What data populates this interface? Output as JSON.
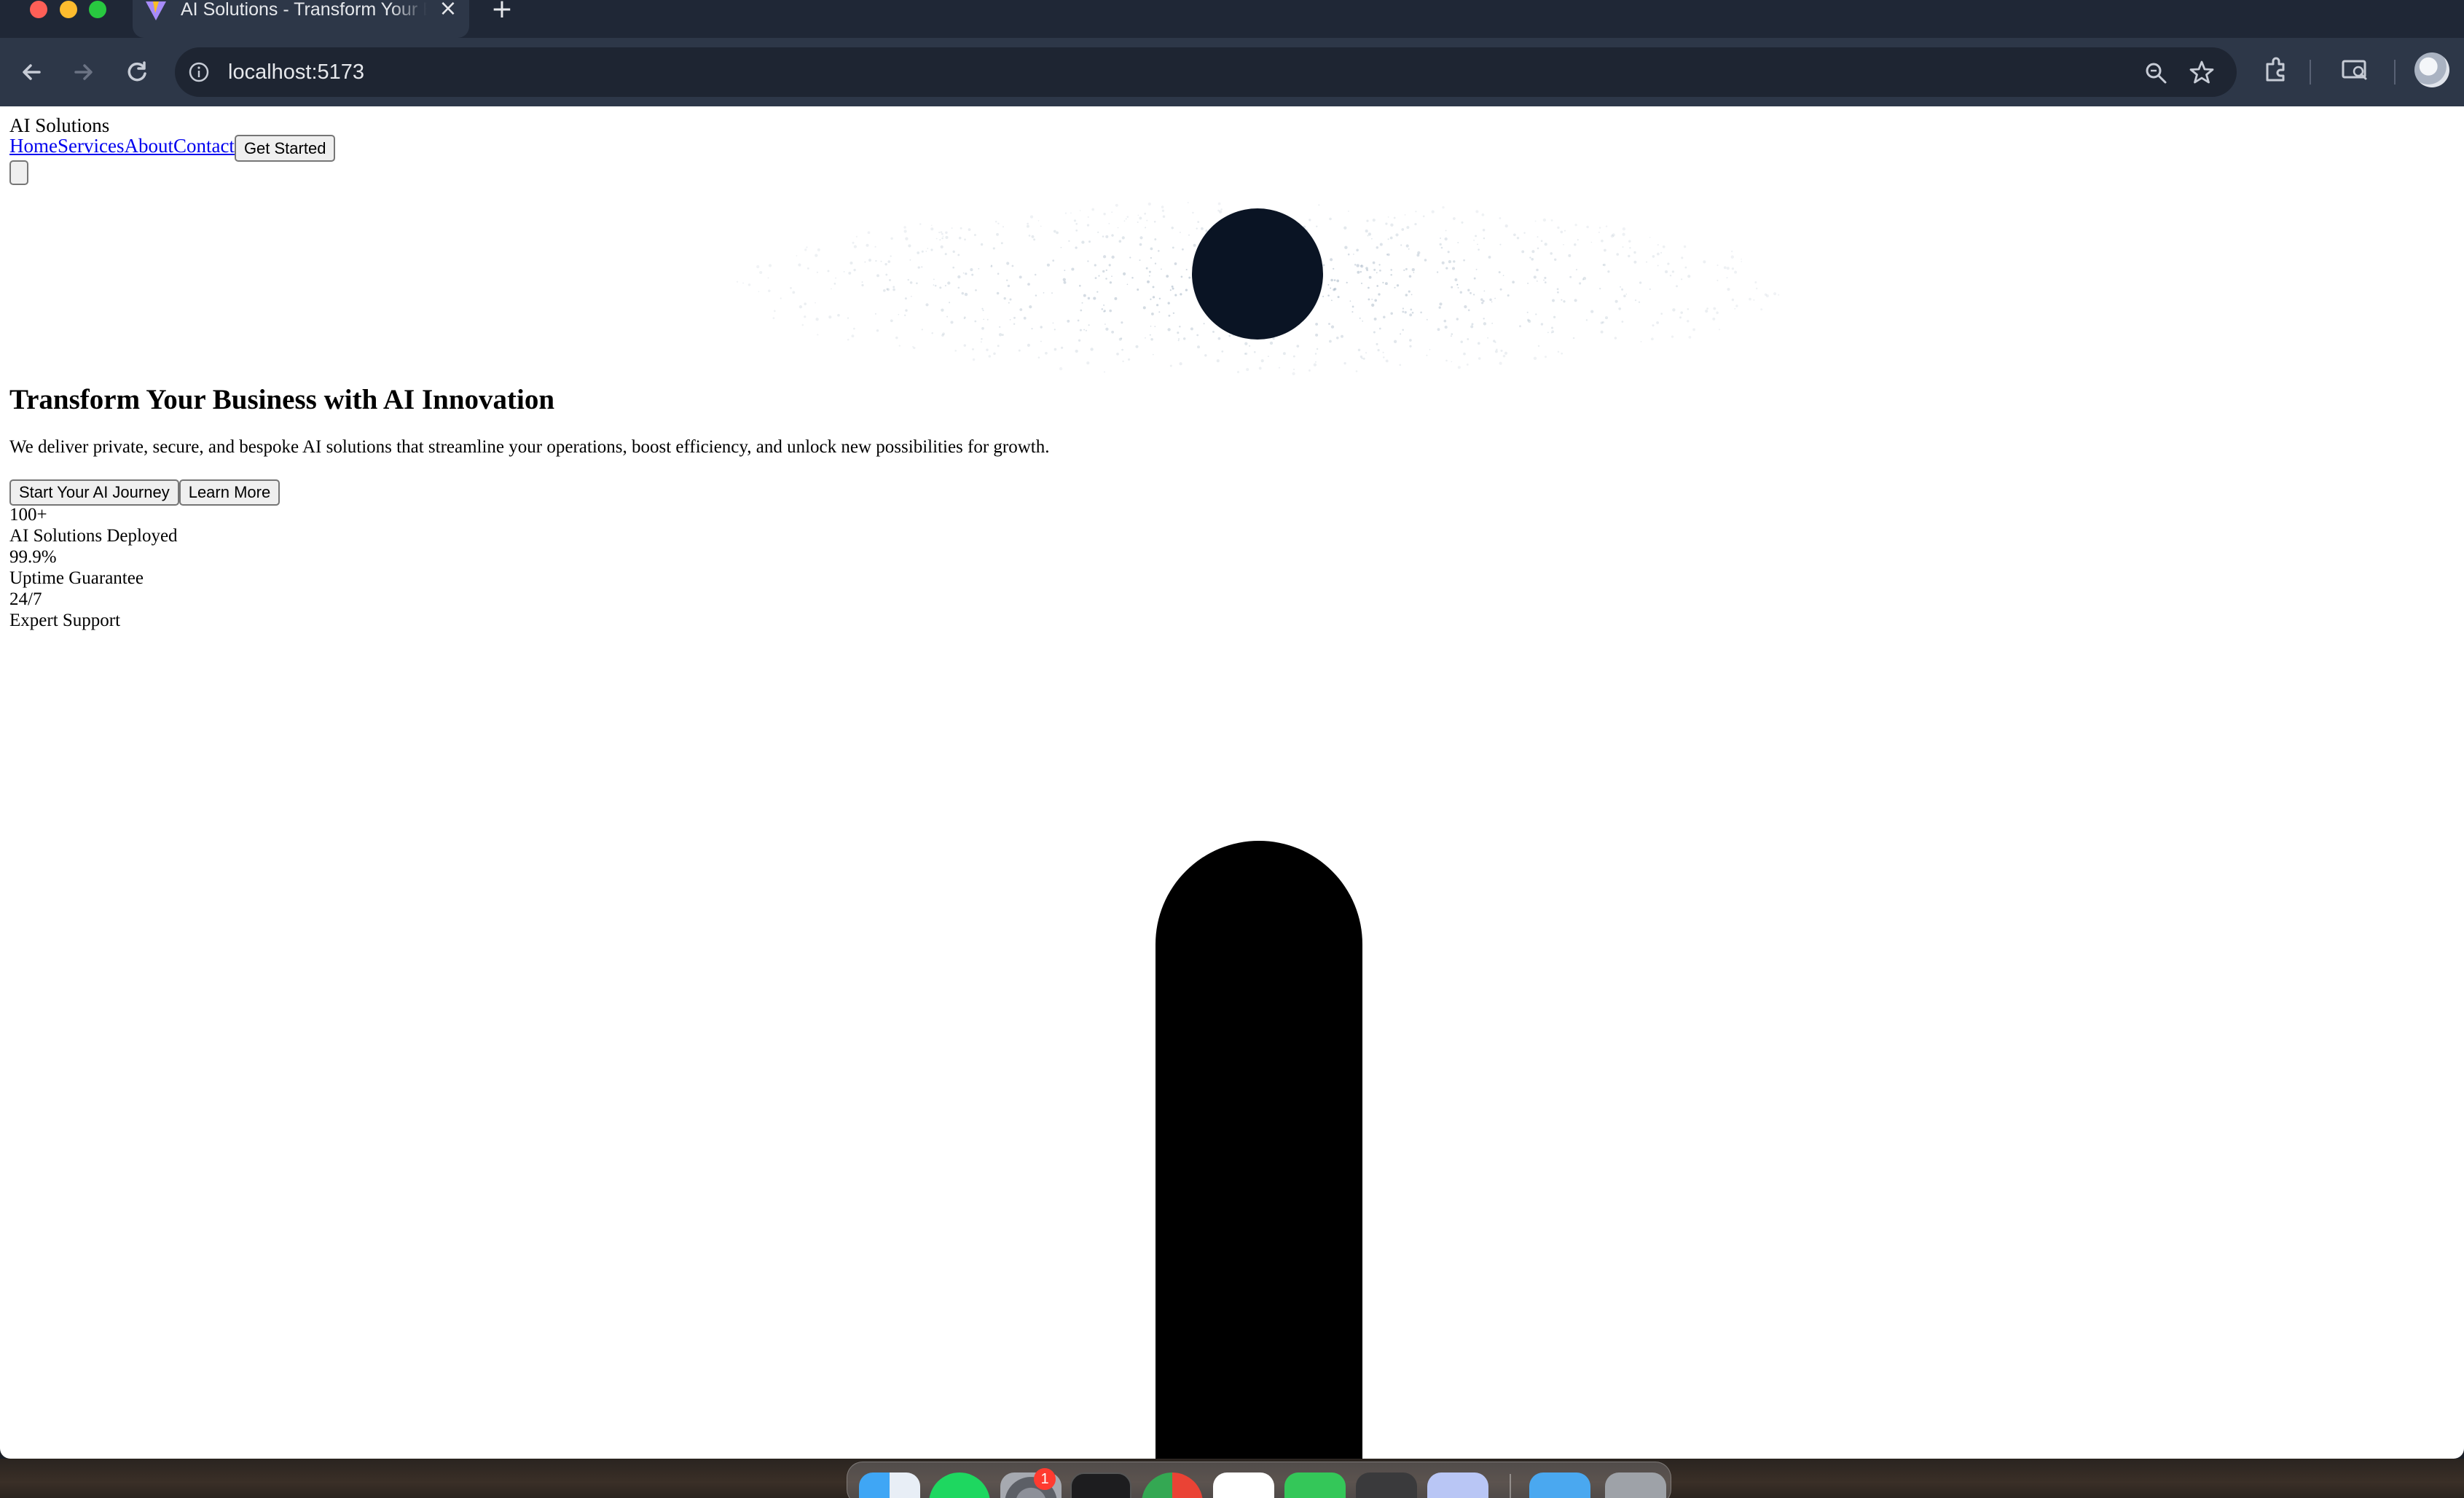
{
  "browser": {
    "tab_title": "AI Solutions - Transform Your Business",
    "tab_close_icon": "close-icon",
    "new_tab_label": "+",
    "url": "localhost:5173",
    "icons": [
      "back-arrow-icon",
      "forward-arrow-icon",
      "reload-icon",
      "info-icon",
      "zoom-icon",
      "star-icon",
      "extensions-icon",
      "cast-icon",
      "profile-avatar"
    ]
  },
  "site": {
    "logo": "AI Solutions",
    "nav": {
      "home": "Home",
      "services": "Services",
      "about": "About",
      "contact": "Contact",
      "get_started": "Get Started"
    },
    "hero": {
      "title": "Transform Your Business with AI Innovation",
      "subtitle": "We deliver private, secure, and bespoke AI solutions that streamline your operations, boost efficiency, and unlock new possibilities for growth.",
      "primary_cta": "Start Your AI Journey",
      "secondary_cta": "Learn More"
    },
    "stats": [
      {
        "value": "100+",
        "label": "AI Solutions Deployed"
      },
      {
        "value": "99.9%",
        "label": "Uptime Guarantee"
      },
      {
        "value": "24/7",
        "label": "Expert Support"
      }
    ]
  },
  "dock": {
    "apps": [
      "finder-icon",
      "spotify-icon",
      "system-settings-icon",
      "terminal-icon",
      "chrome-icon",
      "chatgpt-icon",
      "messages-icon",
      "sublime-text-icon",
      "preview-icon",
      "folder-icon",
      "trash-icon"
    ],
    "badge": "1"
  },
  "colors": {
    "chrome_dark": "#1f2736",
    "toolbar": "#2d3748",
    "link": "#0000ee",
    "hero_orb": "#0a1424"
  }
}
